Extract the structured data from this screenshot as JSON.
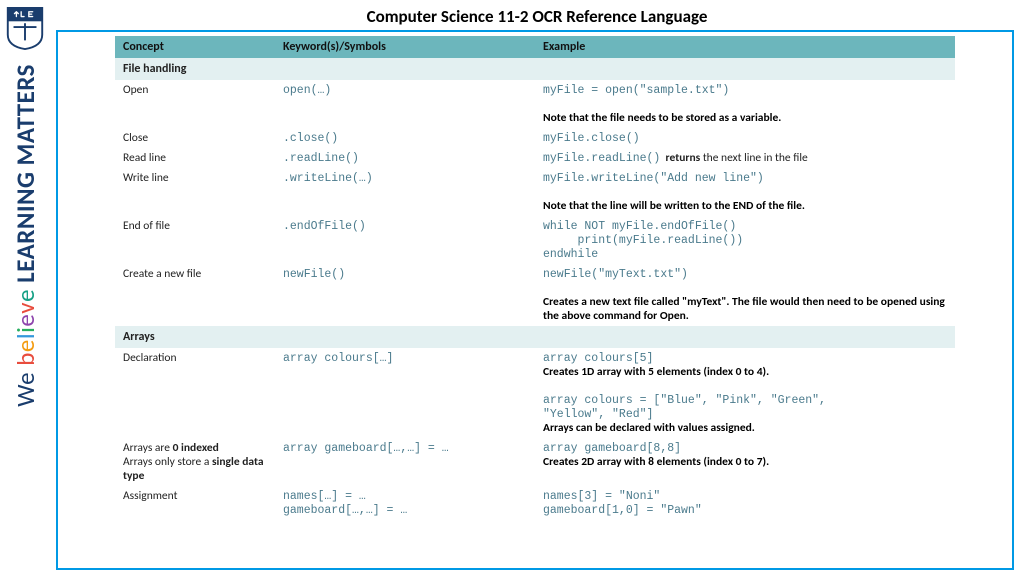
{
  "sidebar": {
    "we": "We ",
    "b": "b",
    "e1": "e",
    "l": "l",
    "i": "i",
    "e2": "e",
    "v": "v",
    "e3": "e",
    "learn": " LEARNING MATTERS"
  },
  "title": "Computer Science 11-2 OCR Reference Language",
  "headers": {
    "concept": "Concept",
    "keyword": "Keyword(s)/Symbols",
    "example": "Example"
  },
  "sections": {
    "file": "File handling",
    "arrays": "Arrays"
  },
  "file": {
    "open": {
      "concept": "Open",
      "keyword": "open(…)",
      "example": "myFile = open(\"sample.txt\")",
      "note": "Note that the file needs to be stored as a variable."
    },
    "close": {
      "concept": "Close",
      "keyword": ".close()",
      "example": "myFile.close()"
    },
    "readline": {
      "concept": "Read line",
      "keyword": ".readLine()",
      "example": "myFile.readLine()",
      "returns_b": "returns",
      "returns_rest": " the next line in the file"
    },
    "writeline": {
      "concept": "Write line",
      "keyword": ".writeLine(…)",
      "example": "myFile.writeLine(\"Add new line\")",
      "note": "Note that the line will be written to the END of the file."
    },
    "eof": {
      "concept": "End of file",
      "keyword": ".endOfFile()",
      "example": "while NOT myFile.endOfFile()\n     print(myFile.readLine())\nendwhile"
    },
    "newfile": {
      "concept": "Create a new file",
      "keyword": "newFile()",
      "example": "newFile(\"myText.txt\")",
      "note": "Creates a new text file called \"myText\". The file would then need to be opened using the above command for Open."
    }
  },
  "arrays": {
    "decl": {
      "concept": "Declaration",
      "keyword": "array colours[…]",
      "ex1": "array colours[5]",
      "note1": "Creates 1D array with 5 elements (index 0 to 4).",
      "ex2": "array colours = [\"Blue\", \"Pink\", \"Green\",\n\"Yellow\", \"Red\"]",
      "note2": "Arrays can be declared with values assigned."
    },
    "twod": {
      "concept_line1a": "Arrays are ",
      "concept_line1b": "0 indexed",
      "concept_line2a": "Arrays only store a ",
      "concept_line2b": "single data type",
      "keyword": "array gameboard[…,…] = …",
      "ex": "array gameboard[8,8]",
      "note": "Creates 2D array with 8 elements (index 0 to 7)."
    },
    "assign": {
      "concept": "Assignment",
      "keyword": "names[…] = …\ngameboard[…,…] = …",
      "ex": "names[3] = \"Noni\"\ngameboard[1,0] = \"Pawn\""
    }
  }
}
